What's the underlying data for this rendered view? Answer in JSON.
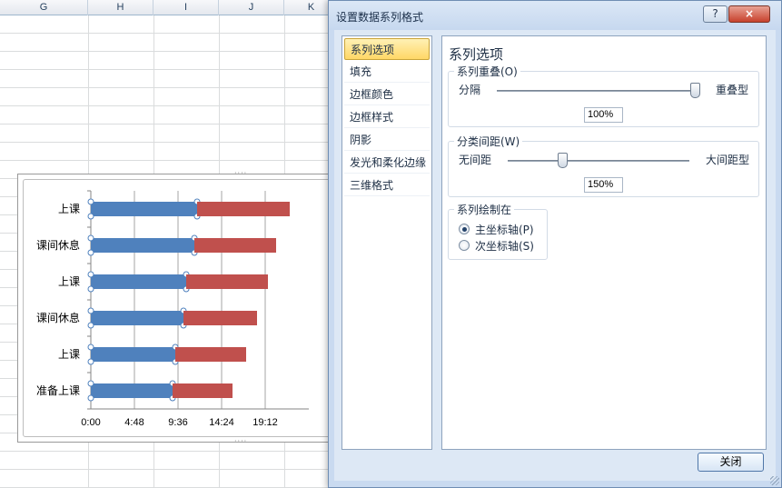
{
  "sheet": {
    "columns": [
      "G",
      "H",
      "I",
      "J",
      "K"
    ]
  },
  "chart_data": {
    "type": "bar",
    "orientation": "horizontal",
    "stacked": true,
    "categories": [
      "准备上课",
      "上课",
      "课间休息",
      "上课",
      "课间休息",
      "上课"
    ],
    "series": [
      {
        "values": [
          0.3,
          0.31,
          0.34,
          0.35,
          0.38,
          0.39
        ],
        "color": "#4f81bd",
        "selected": true
      },
      {
        "values": [
          0.22,
          0.26,
          0.27,
          0.3,
          0.3,
          0.34
        ],
        "color": "#c0504d"
      }
    ],
    "x_unit": "fraction of a day",
    "x_ticks": [
      "0:00",
      "4:48",
      "9:36",
      "14:24",
      "19:12"
    ],
    "xlim": [
      0,
      0.8
    ],
    "grid": "vertical"
  },
  "dialog": {
    "title": "设置数据系列格式",
    "help_label": "?",
    "close_icon": "×",
    "nav": [
      "系列选项",
      "填充",
      "边框颜色",
      "边框样式",
      "阴影",
      "发光和柔化边缘",
      "三维格式"
    ],
    "panel_title": "系列选项",
    "overlap": {
      "label": "系列重叠(O)",
      "left": "分隔",
      "right": "重叠型",
      "value": "100%",
      "slider_percent": 100
    },
    "gap": {
      "label": "分类间距(W)",
      "left": "无间距",
      "right": "大间距型",
      "value": "150%",
      "slider_percent": 30
    },
    "plot_on": {
      "label": "系列绘制在",
      "options": [
        "主坐标轴(P)",
        "次坐标轴(S)"
      ],
      "selected": 0
    },
    "close_label": "关闭"
  },
  "colors": {
    "dialog_bg": "#c9daf0",
    "nav_active": "#ffd766"
  }
}
